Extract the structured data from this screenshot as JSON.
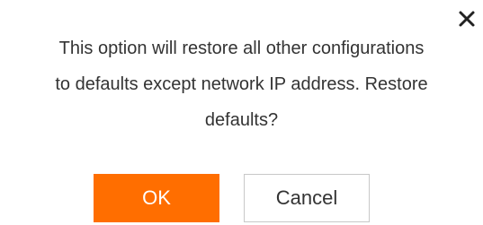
{
  "dialog": {
    "message_lines": [
      "This option will restore all other configurations",
      "to defaults except network IP address. Restore",
      "defaults?"
    ],
    "close_icon": "close-icon"
  },
  "buttons": {
    "ok_label": "OK",
    "cancel_label": "Cancel"
  },
  "colors": {
    "primary": "#ff6e00",
    "text": "#333333",
    "border": "#c8c8c8"
  }
}
